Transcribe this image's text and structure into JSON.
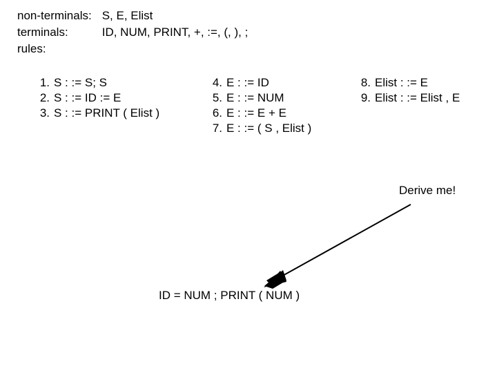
{
  "defs": {
    "nonterminals_label": "non-terminals:",
    "nonterminals_value": "S, E, Elist",
    "terminals_label": "terminals:",
    "terminals_value": "ID, NUM, PRINT, +, :=, (, ), ;",
    "rules_label": "rules:"
  },
  "rules": {
    "col1": [
      {
        "n": "1.",
        "body": "S : := S; S"
      },
      {
        "n": "2.",
        "body": "S : := ID := E"
      },
      {
        "n": "3.",
        "body": "S : := PRINT ( Elist )"
      }
    ],
    "col2": [
      {
        "n": "4.",
        "body": "E : := ID"
      },
      {
        "n": "5.",
        "body": "E : := NUM"
      },
      {
        "n": "6.",
        "body": "E : := E + E"
      },
      {
        "n": "7.",
        "body": "E : := ( S , Elist )"
      }
    ],
    "col3": [
      {
        "n": "8.",
        "body": "Elist : := E"
      },
      {
        "n": "9.",
        "body": "Elist : := Elist , E"
      }
    ]
  },
  "derive_label": "Derive me!",
  "expression": "ID = NUM ; PRINT ( NUM )"
}
